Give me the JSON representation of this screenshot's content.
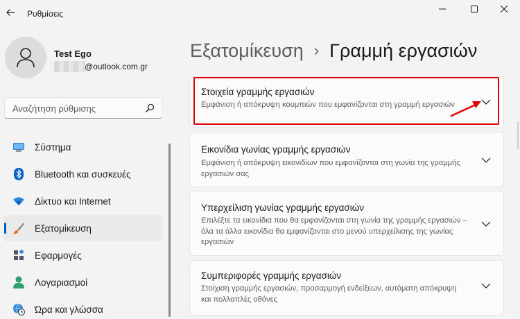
{
  "window": {
    "title": "Ρυθμίσεις",
    "icons": {
      "back": "back-arrow-icon",
      "minimize": "minimize-icon",
      "maximize": "maximize-icon",
      "close": "close-icon"
    }
  },
  "profile": {
    "name": "Test Ego",
    "email_domain": "@outlook.com.gr",
    "avatar_icon": "user-avatar-icon"
  },
  "search": {
    "placeholder": "Αναζήτηση ρύθμισης",
    "icon": "search-icon"
  },
  "nav": {
    "items": [
      {
        "label": "Σύστημα",
        "icon": "monitor-icon",
        "active": false
      },
      {
        "label": "Bluetooth και συσκευές",
        "icon": "bluetooth-icon",
        "active": false
      },
      {
        "label": "Δίκτυο και Internet",
        "icon": "wifi-icon",
        "active": false
      },
      {
        "label": "Εξατομίκευση",
        "icon": "paintbrush-icon",
        "active": true
      },
      {
        "label": "Εφαρμογές",
        "icon": "apps-icon",
        "active": false
      },
      {
        "label": "Λογαριασμοί",
        "icon": "account-icon",
        "active": false
      },
      {
        "label": "Ώρα και γλώσσα",
        "icon": "clock-globe-icon",
        "active": false
      }
    ]
  },
  "header": {
    "parent": "Εξατομίκευση",
    "separator": "›",
    "current": "Γραμμή εργασιών"
  },
  "cards": [
    {
      "title": "Στοιχεία γραμμής εργασιών",
      "description": "Εμφάνιση ή απόκρυψη κουμπιών που εμφανίζονται στη γραμμή εργασιών",
      "icon": "chevron-down-icon",
      "highlighted": true
    },
    {
      "title": "Εικονίδια γωνίας γραμμής εργασιών",
      "description": "Εμφάνιση ή απόκρυψη εικονιδίων που εμφανίζονται στη γωνία της γραμμής εργασιών σας",
      "icon": "chevron-down-icon",
      "highlighted": false
    },
    {
      "title": "Υπερχείλιση γωνίας γραμμής εργασιών",
      "description": "Επιλέξτε τα εικονίδια που θα εμφανίζονται στη γωνία της γραμμής εργασιών – όλα τα άλλα εικονίδια θα εμφανίζονται στο μενού υπερχείλισης της γωνίας εργασιών",
      "icon": "chevron-down-icon",
      "highlighted": false
    },
    {
      "title": "Συμπεριφορές γραμμής εργασιών",
      "description": "Στοίχιση γραμμής εργασιών, προσαρμογή ενδείξεων, αυτόματη απόκρυψη και πολλαπλές οθόνες",
      "icon": "chevron-down-icon",
      "highlighted": false
    }
  ],
  "colors": {
    "accent": "#005fb8",
    "annotation": "#e00000",
    "background": "#f3f3f3",
    "card": "#fbfbfb"
  }
}
